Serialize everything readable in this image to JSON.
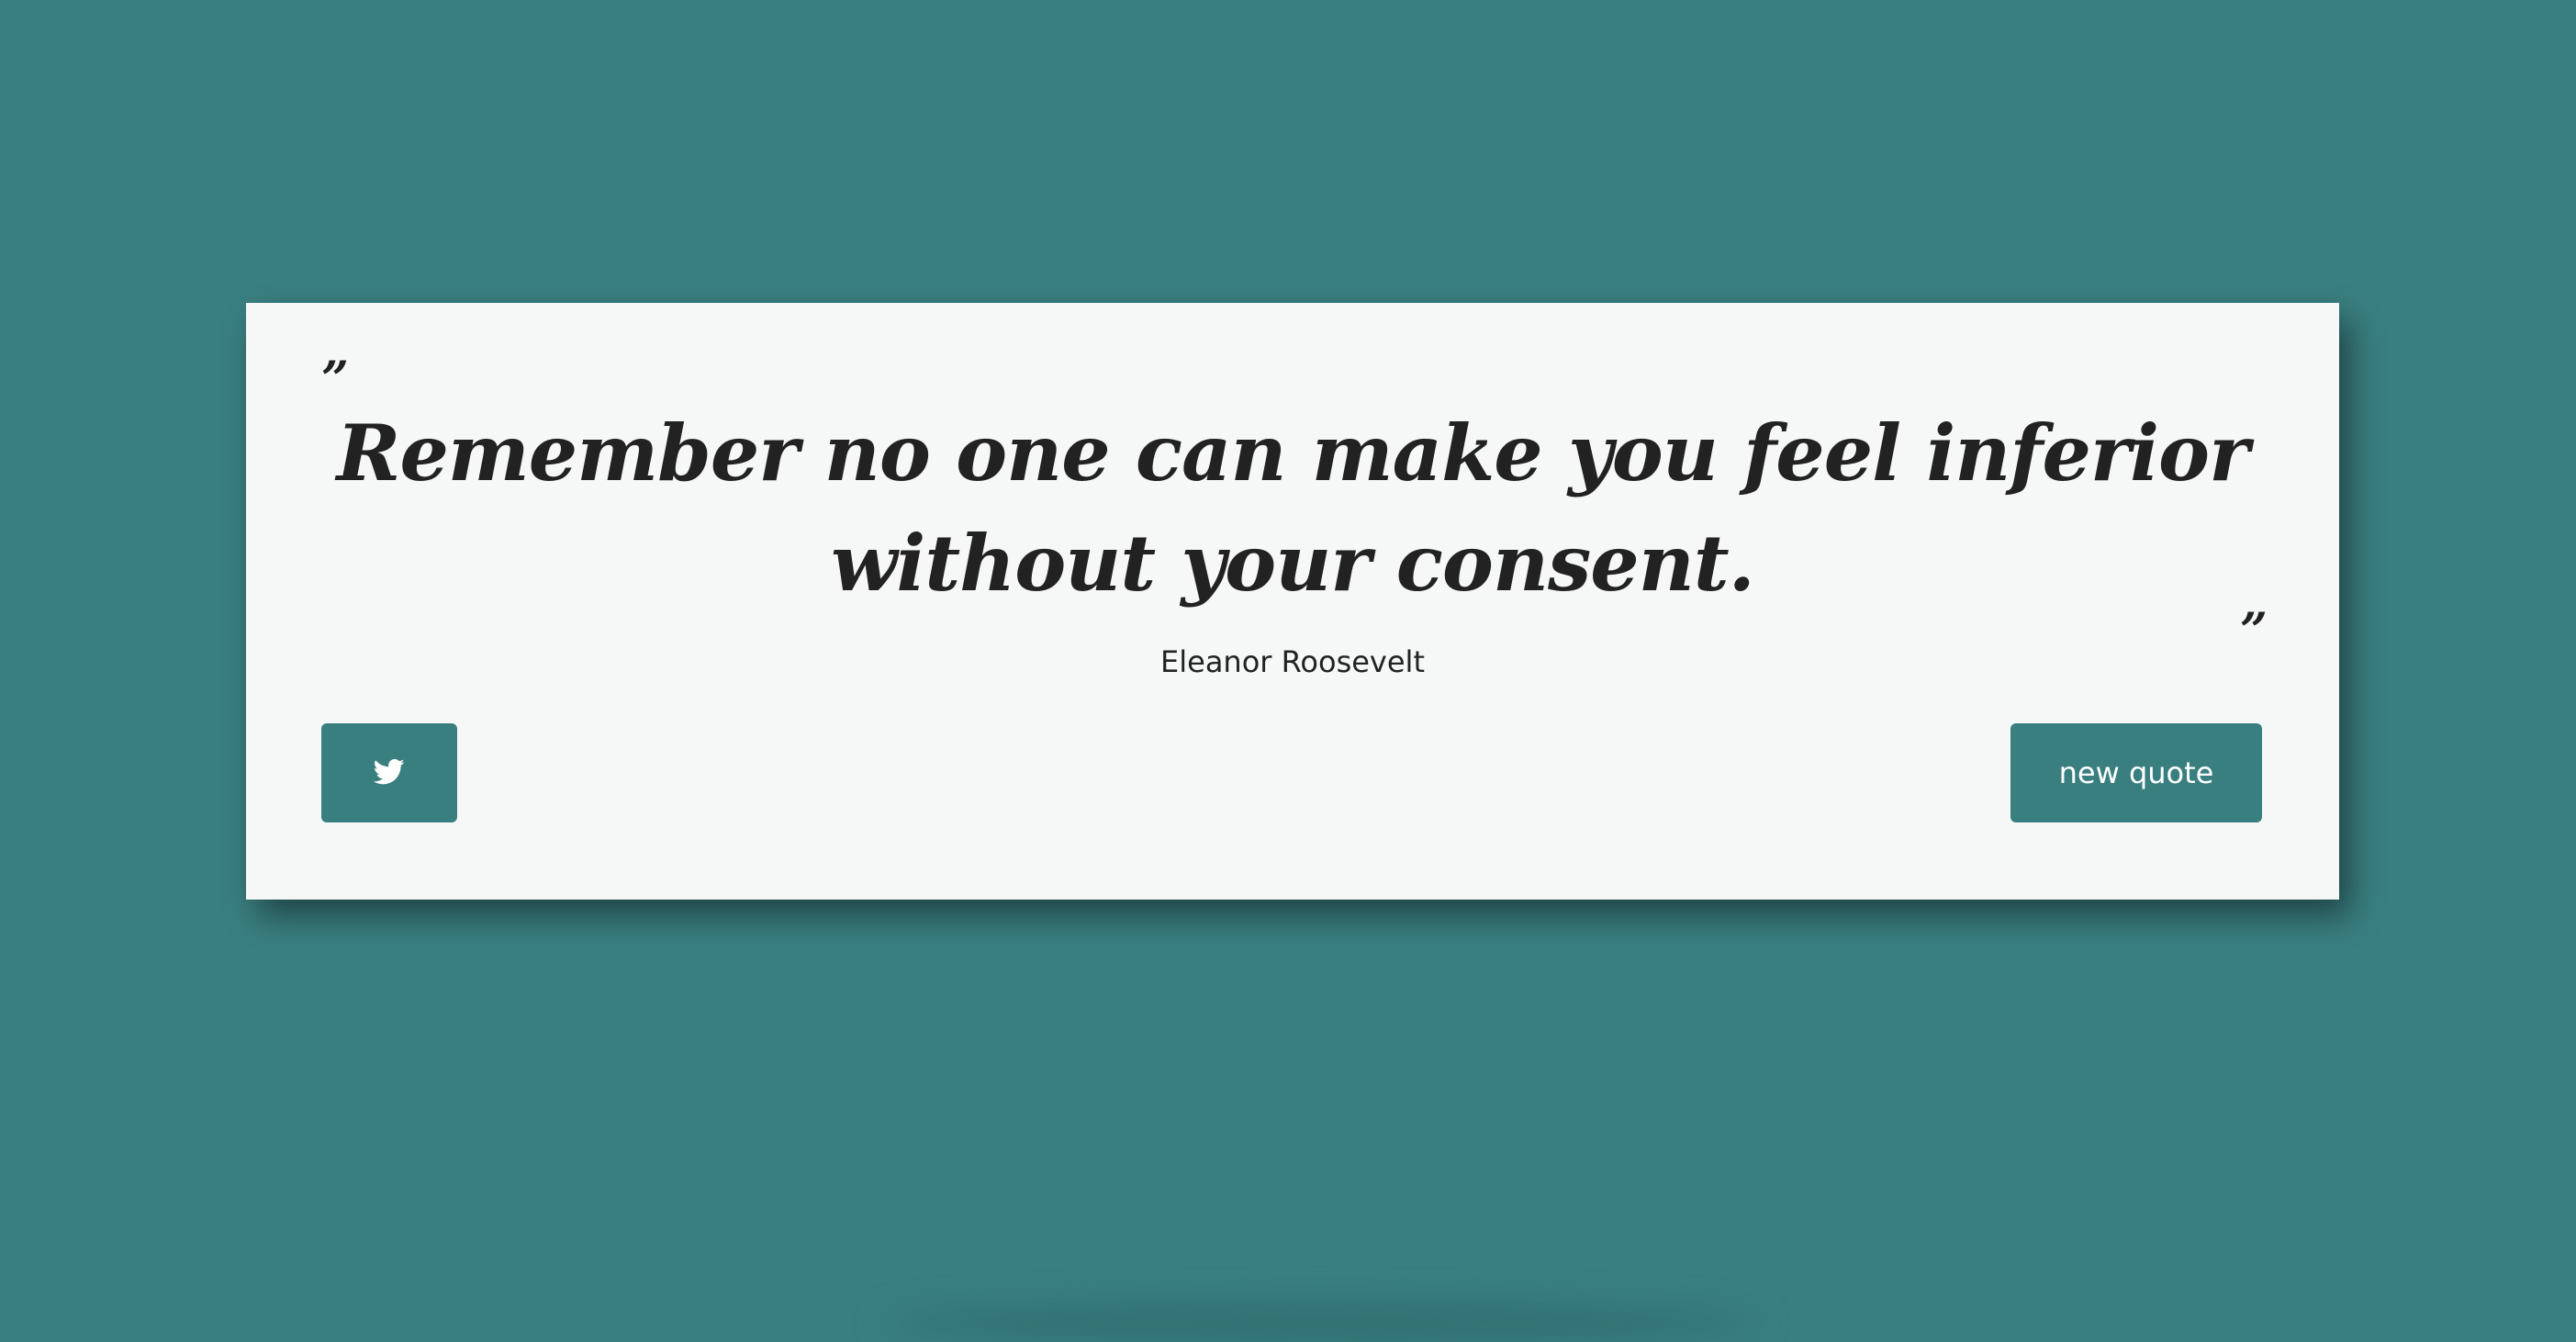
{
  "quote": {
    "open_mark": "”",
    "text": "Remember no one can make you feel inferior without your consent.",
    "close_mark": "”",
    "author": "Eleanor Roosevelt"
  },
  "actions": {
    "tweet_icon": "twitter-icon",
    "new_quote_label": "new quote"
  },
  "colors": {
    "background": "#3a7f80",
    "card": "#f5f8f7",
    "text": "#222222",
    "button": "#3a7f80",
    "button_text": "#ffffff"
  }
}
